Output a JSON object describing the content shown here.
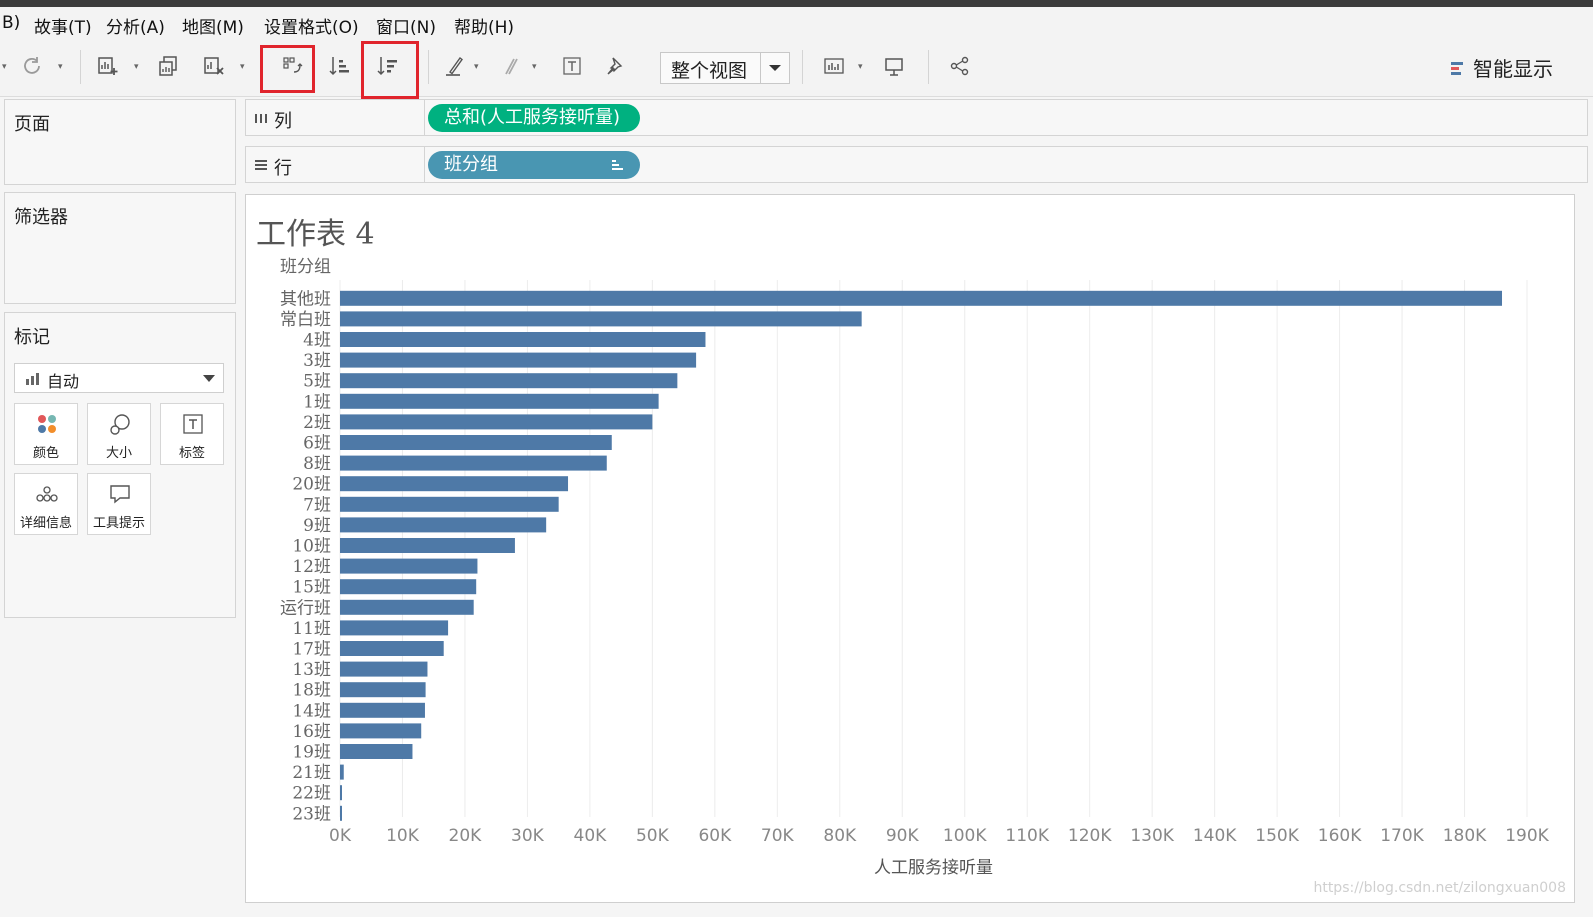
{
  "menu": [
    "B)",
    "故事(T)",
    "分析(A)",
    "地图(M)",
    "设置格式(O)",
    "窗口(N)",
    "帮助(H)"
  ],
  "toolbar": {
    "fit_label": "整个视图",
    "smart_show": "智能显示"
  },
  "left_panels": {
    "pages": "页面",
    "filters": "筛选器",
    "marks": "标记",
    "mark_type": "自动",
    "mark_cards": [
      "颜色",
      "大小",
      "标签",
      "详细信息",
      "工具提示"
    ]
  },
  "shelves": {
    "columns_label": "列",
    "columns_pill": "总和(人工服务接听量)",
    "rows_label": "行",
    "rows_pill": "班分组"
  },
  "sheet_title": "工作表 4",
  "chart_data": {
    "type": "bar",
    "orientation": "horizontal",
    "row_header": "班分组",
    "categories": [
      "其他班",
      "常白班",
      "4班",
      "3班",
      "5班",
      "1班",
      "2班",
      "6班",
      "8班",
      "20班",
      "7班",
      "9班",
      "10班",
      "12班",
      "15班",
      "运行班",
      "11班",
      "17班",
      "13班",
      "18班",
      "14班",
      "16班",
      "19班",
      "21班",
      "22班",
      "23班"
    ],
    "values": [
      186000,
      83500,
      58500,
      57000,
      54000,
      51000,
      50000,
      43500,
      42700,
      36500,
      35000,
      33000,
      28000,
      22000,
      21800,
      21400,
      17300,
      16600,
      14000,
      13700,
      13600,
      13000,
      11600,
      600,
      300,
      250
    ],
    "xlabel": "人工服务接听量",
    "x_ticks": [
      "0K",
      "10K",
      "20K",
      "30K",
      "40K",
      "50K",
      "60K",
      "70K",
      "80K",
      "90K",
      "100K",
      "110K",
      "120K",
      "130K",
      "140K",
      "150K",
      "160K",
      "170K",
      "180K",
      "190K"
    ],
    "xlim": [
      0,
      190000
    ],
    "grid": true,
    "bar_color": "#4e79a7"
  },
  "watermark": "https://blog.csdn.net/zilongxuan008",
  "colors": {
    "columns_pill": "#00b180",
    "rows_pill": "#4996b2",
    "highlight": "#e0242c"
  }
}
